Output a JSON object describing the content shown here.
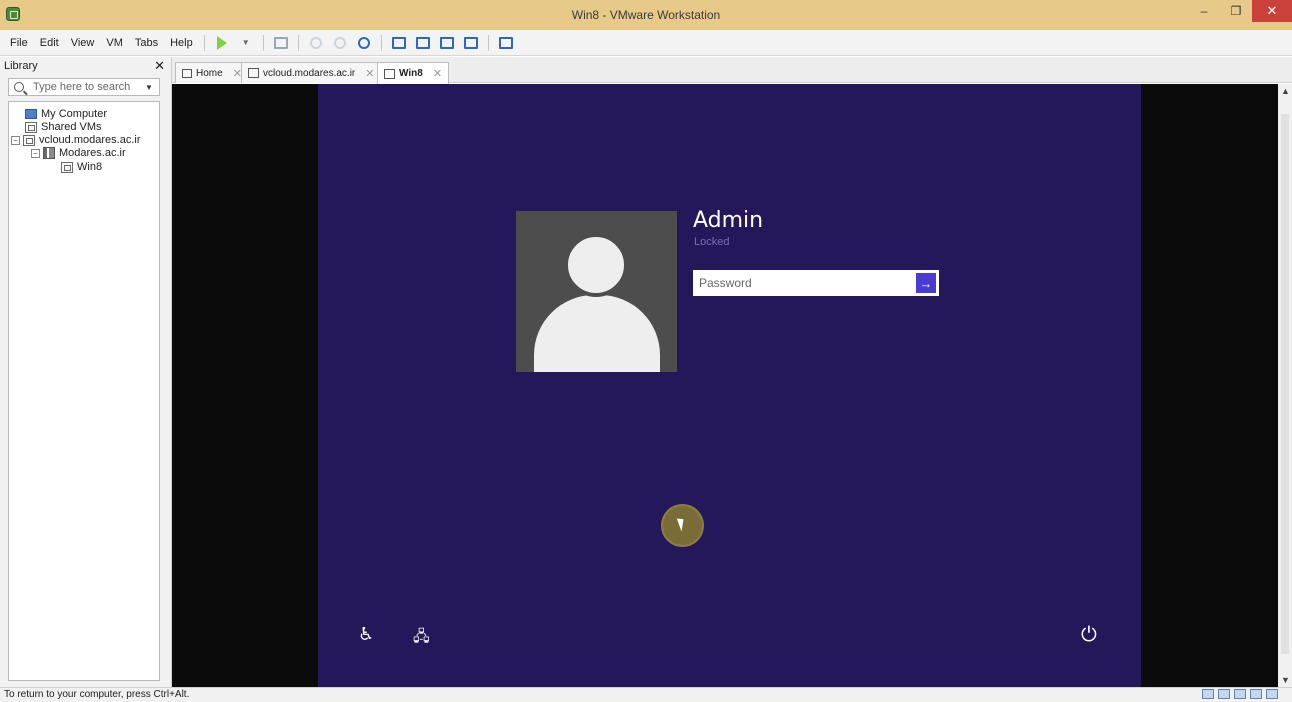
{
  "window": {
    "title": "Win8 - VMware Workstation",
    "minimize": "–",
    "maximize": "❐",
    "close": "✕"
  },
  "menu": {
    "items": [
      "File",
      "Edit",
      "View",
      "VM",
      "Tabs",
      "Help"
    ]
  },
  "library": {
    "title": "Library",
    "close": "✕",
    "search_placeholder": "Type here to search",
    "tree": [
      {
        "label": "My Computer"
      },
      {
        "label": "Shared VMs"
      },
      {
        "label": "vcloud.modares.ac.ir"
      },
      {
        "label": "Modares.ac.ir"
      },
      {
        "label": "Win8"
      }
    ]
  },
  "tabs": [
    {
      "label": "Home",
      "close": "✕"
    },
    {
      "label": "vcloud.modares.ac.ir",
      "close": "✕"
    },
    {
      "label": "Win8",
      "close": "✕"
    }
  ],
  "lockscreen": {
    "username": "Admin",
    "status": "Locked",
    "password_placeholder": "Password",
    "submit_glyph": "→",
    "ease_glyph": "♿",
    "network_glyph": "🖧",
    "power_glyph": "⏻"
  },
  "scrollbar": {
    "up": "▲",
    "down": "▼"
  },
  "statusbar": {
    "text": "To return to your computer, press Ctrl+Alt."
  },
  "colors": {
    "titlebar": "#e7c98a",
    "lockscreen_bg": "#24175a",
    "submit_button": "#4a3bd1",
    "close_button": "#c9413a"
  }
}
